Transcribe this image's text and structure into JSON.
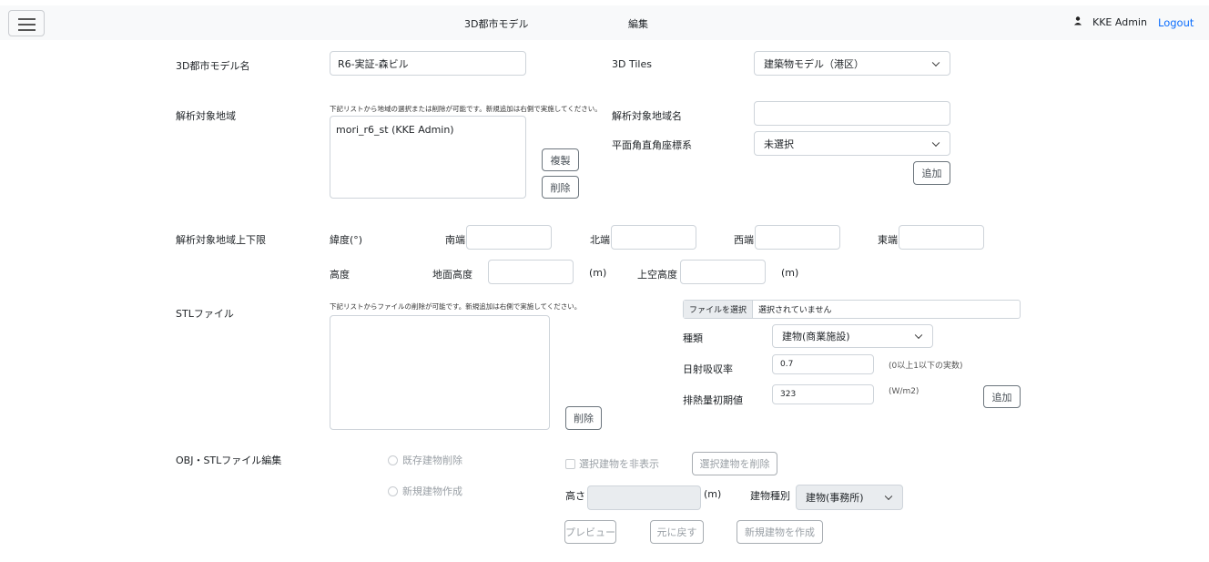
{
  "navbar": {
    "title": "3D都市モデル",
    "mode": "編集",
    "user": "KKE Admin",
    "logout": "Logout"
  },
  "city_model": {
    "name_label": "3D都市モデル名",
    "name_value": "R6-実証-森ビル",
    "tiles_label": "3D Tiles",
    "tiles_value": "建築物モデル（港区）"
  },
  "region": {
    "label": "解析対象地域",
    "hint": "下記リストから地域の選択または削除が可能です。新規追加は右側で実施してください。",
    "items": [
      "mori_r6_st (KKE Admin)"
    ],
    "copy_button": "複製",
    "delete_button": "削除",
    "name_label": "解析対象地域名",
    "name_value": "",
    "crs_label": "平面角直角座標系",
    "crs_value": "未選択",
    "add_button": "追加"
  },
  "bounds": {
    "label": "解析対象地域上下限",
    "lat_label": "緯度(°)",
    "south_label": "南端",
    "north_label": "北端",
    "west_label": "西端",
    "east_label": "東端",
    "height_label": "高度",
    "ground_label": "地面高度",
    "sky_label": "上空高度",
    "unit_m": "(m)"
  },
  "stl": {
    "label": "STLファイル",
    "hint": "下記リストからファイルの削除が可能です。新規追加は右側で実施してください。",
    "delete_button": "削除",
    "file_button": "ファイルを選択",
    "file_status": "選択されていません",
    "type_label": "種類",
    "type_value": "建物(商業施設)",
    "absorb_label": "日射吸収率",
    "absorb_value": "0.7",
    "absorb_hint": "(0以上1以下の実数)",
    "heat_label": "排熱量初期値",
    "heat_value": "323",
    "heat_unit": "(W/m2)",
    "add_button": "追加"
  },
  "obj_edit": {
    "label": "OBJ・STLファイル編集",
    "radio_delete": "既存建物削除",
    "radio_create": "新規建物作成",
    "hide_check": "選択建物を非表示",
    "delete_selected": "選択建物を削除",
    "height_label": "高さ",
    "height_value": "",
    "unit_m": "(m)",
    "type_label": "建物種別",
    "type_value": "建物(事務所)",
    "preview_button": "プレビュー",
    "undo_button": "元に戻す",
    "create_button": "新規建物を作成"
  },
  "icons": {
    "menu": "hamburger-icon",
    "user": "person-icon",
    "dropdown": "chevron-down-icon"
  },
  "colors": {
    "link": "#0d6efd",
    "navbar_bg": "#f8f9fa",
    "disabled_bg": "#e9ecef"
  }
}
